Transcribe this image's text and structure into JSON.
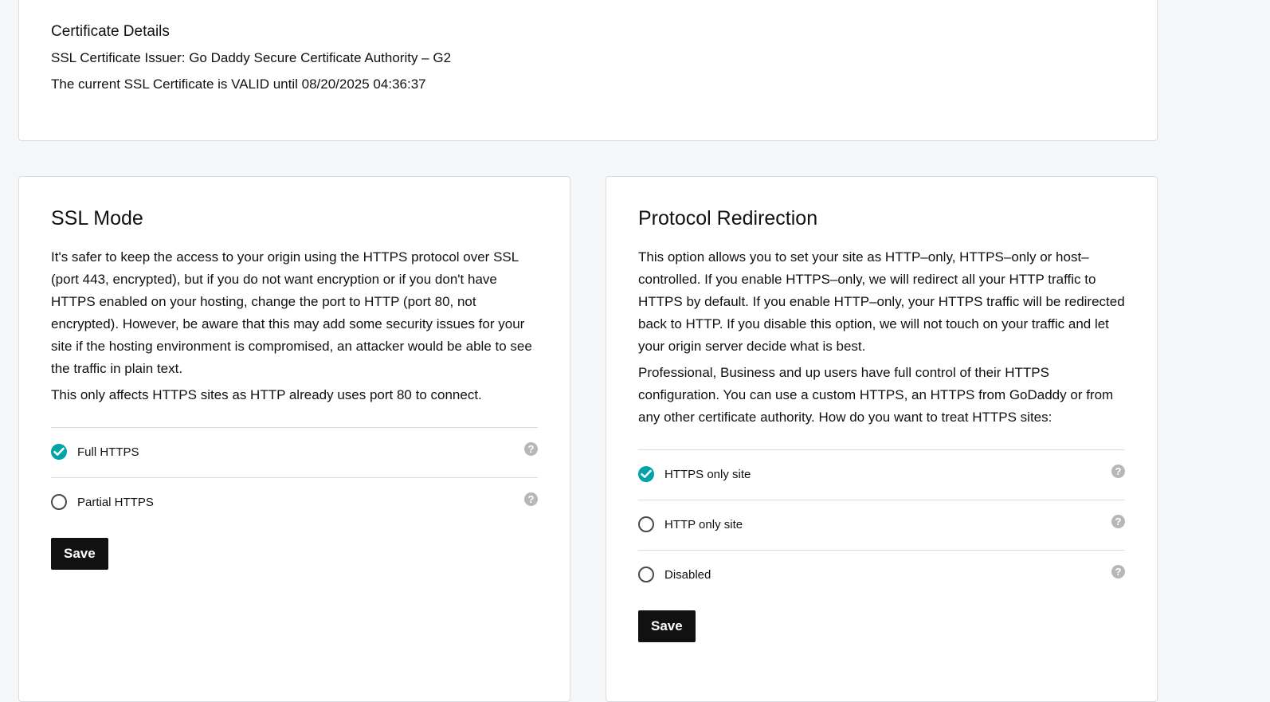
{
  "certificate": {
    "title": "Certificate Details",
    "issuer_line": "SSL Certificate Issuer: Go Daddy Secure Certificate Authority – G2",
    "validity_line": "The current SSL Certificate is VALID until 08/20/2025 04:36:37"
  },
  "ssl_mode": {
    "title": "SSL Mode",
    "paragraphs": [
      "It's safer to keep the access to your origin using the HTTPS protocol over SSL (port 443, encrypted), but if you do not want encryption or if you don't have HTTPS enabled on your hosting, change the port to HTTP (port 80, not encrypted). However, be aware that this may add some security issues for your site if the hosting environment is compromised, an attacker would be able to see the traffic in plain text.",
      "This only affects HTTPS sites as HTTP already uses port 80 to connect."
    ],
    "options": [
      {
        "label": "Full HTTPS",
        "selected": true,
        "help_icon": "question-mark"
      },
      {
        "label": "Partial HTTPS",
        "selected": false,
        "help_icon": "question-mark"
      }
    ],
    "save_label": "Save"
  },
  "protocol_redirection": {
    "title": "Protocol Redirection",
    "paragraphs": [
      "This option allows you to set your site as HTTP–only, HTTPS–only or host–controlled. If you enable HTTPS–only, we will redirect all your HTTP traffic to HTTPS by default. If you enable HTTP–only, your HTTPS traffic will be redirected back to HTTP. If you disable this option, we will not touch on your traffic and let your origin server decide what is best.",
      "Professional, Business and up users have full control of their HTTPS configuration. You can use a custom HTTPS, an HTTPS from GoDaddy or from any other certificate authority. How do you want to treat HTTPS sites:"
    ],
    "options": [
      {
        "label": "HTTPS only site",
        "selected": true,
        "help_icon": "question-mark"
      },
      {
        "label": "HTTP only site",
        "selected": false,
        "help_icon": "question-mark"
      },
      {
        "label": "Disabled",
        "selected": false,
        "help_icon": "question-mark"
      }
    ],
    "save_label": "Save"
  },
  "colors": {
    "accent_selected": "#00a4a6",
    "button_bg": "#111111",
    "page_bg": "#f5f6f7",
    "border": "#d9dde1"
  }
}
